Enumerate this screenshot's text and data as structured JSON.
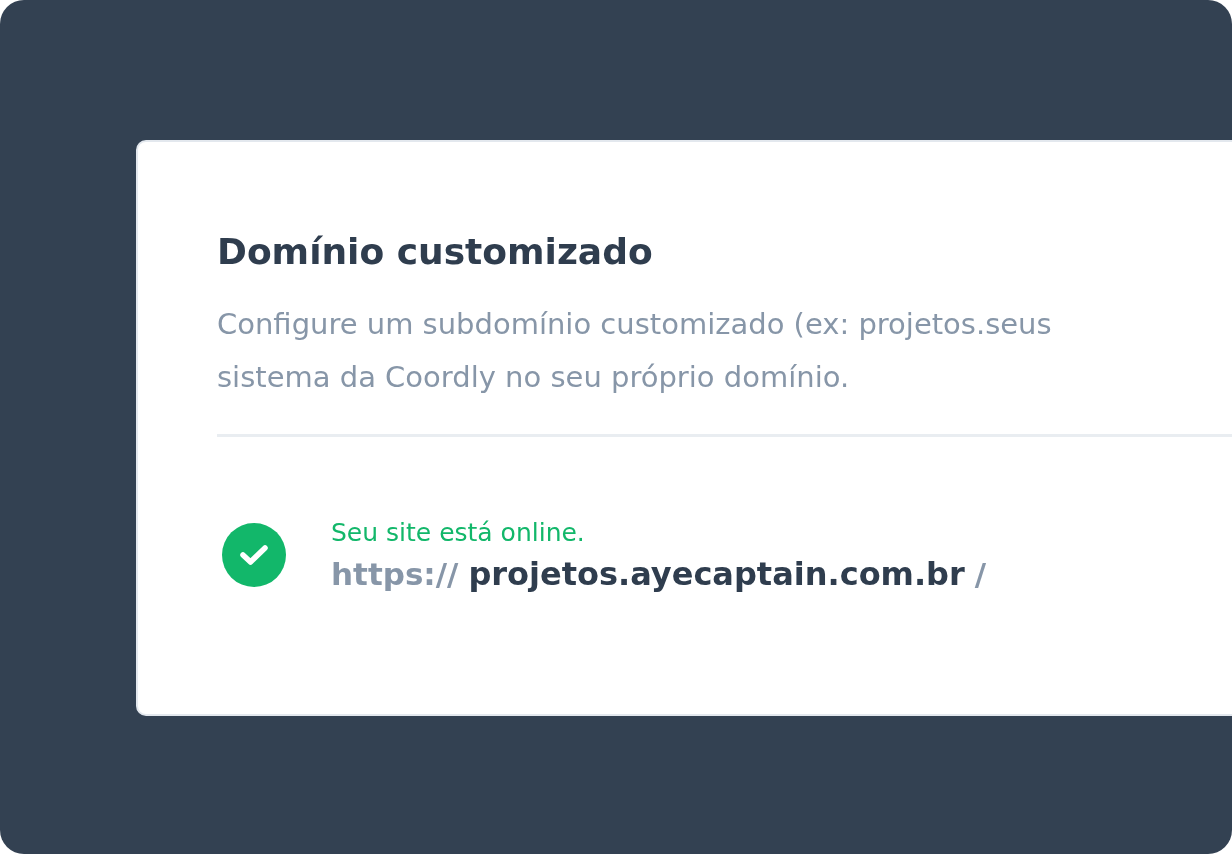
{
  "card": {
    "title": "Domínio customizado",
    "description": "Configure um subdomínio customizado (ex: projetos.seus",
    "description_line_2": "sistema da Coordly no seu próprio domínio.",
    "status": {
      "online": true,
      "message": "Seu site está online.",
      "scheme": "https://",
      "host": "projetos.ayecaptain.com.br",
      "suffix": "/"
    }
  }
}
